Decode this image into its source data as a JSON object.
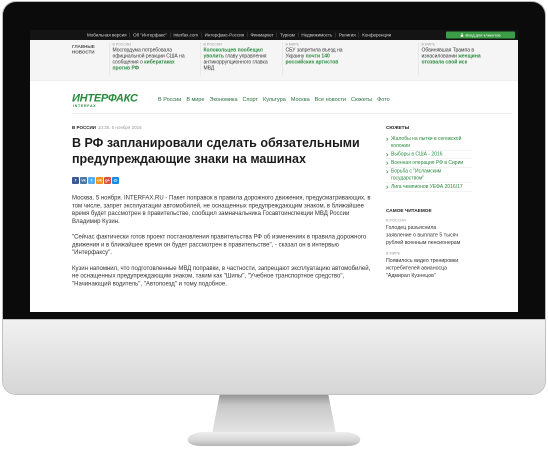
{
  "colors": {
    "brand_green": "#2a8a3e",
    "topbar_bg": "#141414",
    "login_green": "#3d9c46"
  },
  "site": {
    "topbar": {
      "links": [
        "Мобильная версия",
        "Об \"Интерфакс\"",
        "Interfax.com",
        "Интерфакс-Россия",
        "Финмаркет",
        "Туризм",
        "Недвижимость",
        "Религия",
        "Конференции"
      ],
      "login_label": "Вход для клиентов",
      "login_icon": "lock-icon"
    },
    "top_news": {
      "label": "ГЛАВНЫЕ НОВОСТИ",
      "items": [
        {
          "section": "В РОССИИ",
          "before": "Мосгордума потребовала официальной реакции США на сообщения о ",
          "bold": "кибератаках против РФ"
        },
        {
          "section": "В РОССИИ",
          "bold": "Колокольцев пообещал уволить",
          "after": " главу управления антикоррупционного главка МВД"
        },
        {
          "section": "В МИРЕ",
          "before": "СБУ запретила въезд на Украину ",
          "bold": "почти 140 российских артистов"
        },
        {
          "section": "В МИРЕ",
          "before": "Обвинявшая Трампа в изнасиловании ",
          "bold": "женщина отозвала свой иск"
        }
      ]
    },
    "logo": {
      "main": "ИНТЕРФАКС",
      "sub": "INTERFAX"
    },
    "nav": {
      "items": [
        "В России",
        "В мире",
        "Экономика",
        "Спорт",
        "Культура",
        "Москва",
        "Все новости",
        "Сюжеты",
        "Фото"
      ]
    },
    "article": {
      "section": "В РОССИИ",
      "datetime": "10:35, 5 ноября 2016",
      "title": "В РФ запланировали сделать обязательными предупреждающие знаки на машинах",
      "share_icons": [
        {
          "icon": "facebook-icon",
          "glyph": "f",
          "color": "#3b5998"
        },
        {
          "icon": "vk-icon",
          "glyph": "vk",
          "color": "#4c75a3"
        },
        {
          "icon": "twitter-icon",
          "glyph": "t",
          "color": "#55acee"
        },
        {
          "icon": "odnoklassniki-icon",
          "glyph": "ok",
          "color": "#f39219"
        },
        {
          "icon": "google-plus-icon",
          "glyph": "g+",
          "color": "#dc4e41"
        },
        {
          "icon": "mail-icon",
          "glyph": "@",
          "color": "#168de2"
        }
      ],
      "paragraphs": [
        "Москва. 5 ноября. INTERFAX.RU - Пакет поправок в правила дорожного движения, предусматривающих, в том числе, запрет эксплуатации автомобилей, не оснащенных предупреждающим знаком, в ближайшее время будет рассмотрен в правительстве, сообщил замначальника Госавтоинспекции МВД России Владимир Кузин.",
        "\"Сейчас фактически готов проект постановления правительства РФ об изменениях в правила дорожного движения и в ближайшее время он будет рассмотрен в правительстве\", - сказал он в интервью \"Интерфаксу\".",
        "Кузин напомнил, что подготовленные МВД поправки, в частности, запрещают эксплуатацию автомобилей, не оснащенных предупреждающим знаком, таким как \"Шипы\", \"Учебное транспортное средство\", \"Начинающий водитель\", \"Автопоезд\" и тому подобное."
      ]
    },
    "sidebar": {
      "stories_title": "СЮЖЕТЫ",
      "stories": [
        "Жалобы на пытки в сегежской колонии",
        "Выборы в США - 2016",
        "Военная операция РФ в Сирии",
        "Борьба с \"Исламским государством\"",
        "Лига чемпионов УЕФА 2016/17"
      ],
      "popular_title": "САМОЕ ЧИТАЕМОЕ",
      "popular": [
        {
          "section": "В РОССИИ",
          "text": "Голодец разъяснила заявление о выплате 5 тысяч рублей военным пенсионерам"
        },
        {
          "section": "В МИРЕ",
          "text": "Появилось видео тренировки истребителей авианосца \"Адмирал Кузнецов\""
        }
      ]
    }
  }
}
